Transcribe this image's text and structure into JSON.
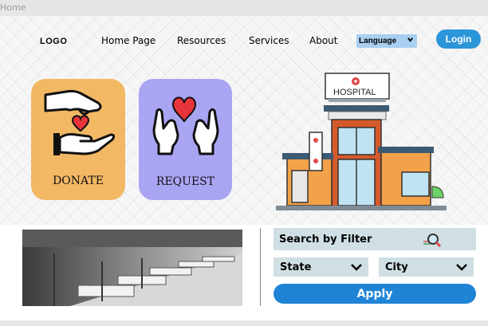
{
  "window": {
    "title": "Home"
  },
  "nav": {
    "logo": "LOGO",
    "links": [
      "Home Page",
      "Resources",
      "Services",
      "About"
    ],
    "language": "Language",
    "login": "Login"
  },
  "cards": {
    "donate": "DONATE",
    "request": "REQUEST"
  },
  "hospital": {
    "sign": "HOSPITAL"
  },
  "search": {
    "filter_label": "Search by Filter",
    "state": "State",
    "city": "City",
    "apply": "Apply"
  },
  "colors": {
    "accent": "#2b95d9",
    "donate_card": "#f2b864",
    "request_card": "#a9a5f3",
    "filter_bg": "#cfdfe3",
    "apply_bg": "#1f84d6"
  },
  "icons": [
    "give-heart-hands-icon",
    "heart-hands-icon",
    "hospital-building-illustration",
    "magnifier-icon",
    "chevron-down-icon"
  ]
}
